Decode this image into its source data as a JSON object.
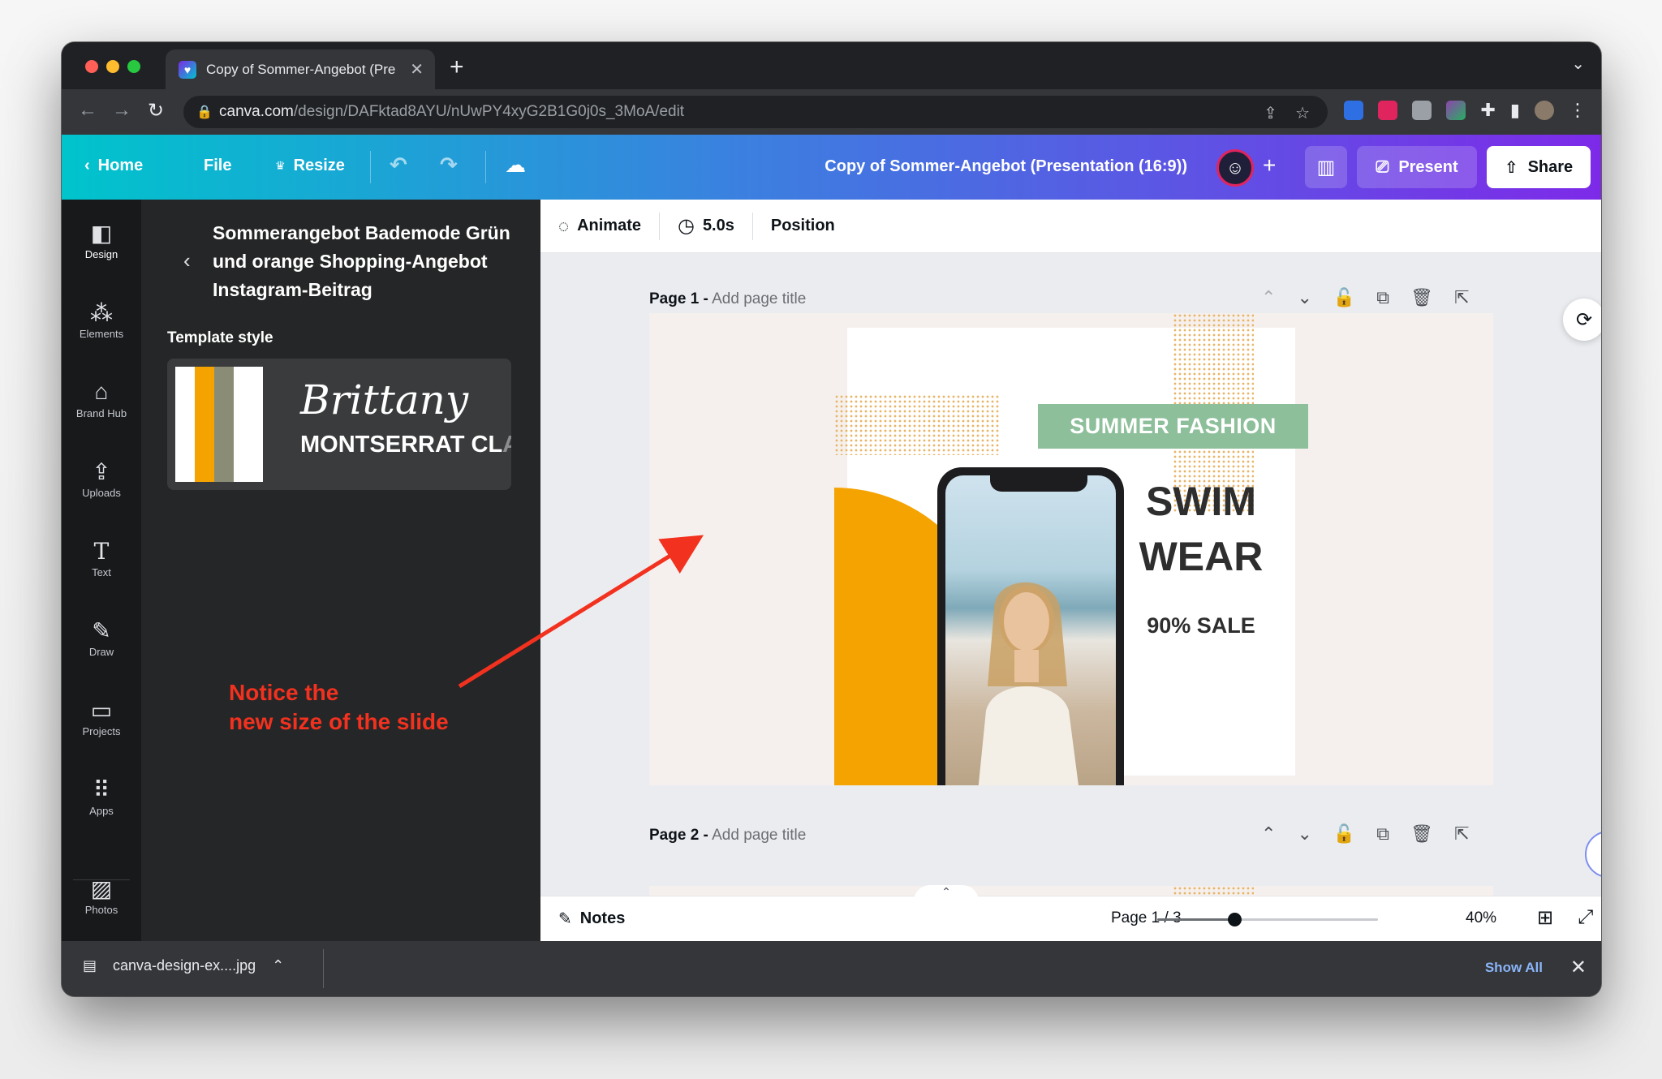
{
  "browser": {
    "tab_title": "Copy of Sommer-Angebot (Pre",
    "url_domain": "canva.com",
    "url_path": "/design/DAFktad8AYU/nUwPY4xyG2B1G0j0s_3MoA/edit"
  },
  "header": {
    "home": "Home",
    "file": "File",
    "resize": "Resize",
    "doc_title": "Copy of Sommer-Angebot (Presentation (16:9))",
    "present": "Present",
    "share": "Share"
  },
  "rail": {
    "items": [
      {
        "label": "Design",
        "icon": "design-icon"
      },
      {
        "label": "Elements",
        "icon": "elements-icon"
      },
      {
        "label": "Brand Hub",
        "icon": "brand-hub-icon"
      },
      {
        "label": "Uploads",
        "icon": "upload-icon"
      },
      {
        "label": "Text",
        "icon": "text-icon"
      },
      {
        "label": "Draw",
        "icon": "draw-icon"
      },
      {
        "label": "Projects",
        "icon": "folder-icon"
      },
      {
        "label": "Apps",
        "icon": "apps-icon"
      },
      {
        "label": "Photos",
        "icon": "photos-icon"
      }
    ]
  },
  "panel": {
    "title": "Sommerangebot Bademode Grün und orange Shopping-Angebot Instagram-Beitrag",
    "template_style_label": "Template style",
    "font_script": "Brittany",
    "font_sans": "MONTSERRAT CL",
    "font_sans_fade": "A",
    "swatches": [
      "#ffffff",
      "#f5a300",
      "#8b8c76",
      "#ffffff"
    ]
  },
  "annotation": {
    "line1": "Notice the",
    "line2": "new size of the slide",
    "color": "#f2311f"
  },
  "context_bar": {
    "animate": "Animate",
    "duration": "5.0s",
    "position": "Position"
  },
  "pages": [
    {
      "label": "Page 1 -",
      "add_title": "Add page title"
    },
    {
      "label": "Page 2 -",
      "add_title": "Add page title"
    }
  ],
  "slide": {
    "banner": "SUMMER FASHION",
    "headline_1": "SWIM",
    "headline_2": "WEAR",
    "sale": "90% SALE",
    "colors": {
      "background": "#f5f0ed",
      "orange": "#f5a300",
      "green": "#8dbf9a"
    }
  },
  "footer": {
    "notes": "Notes",
    "page_count": "Page 1 / 3",
    "zoom": "40%",
    "zoom_fraction": 0.35
  },
  "downloads": {
    "file": "canva-design-ex....jpg",
    "show_all": "Show All"
  }
}
